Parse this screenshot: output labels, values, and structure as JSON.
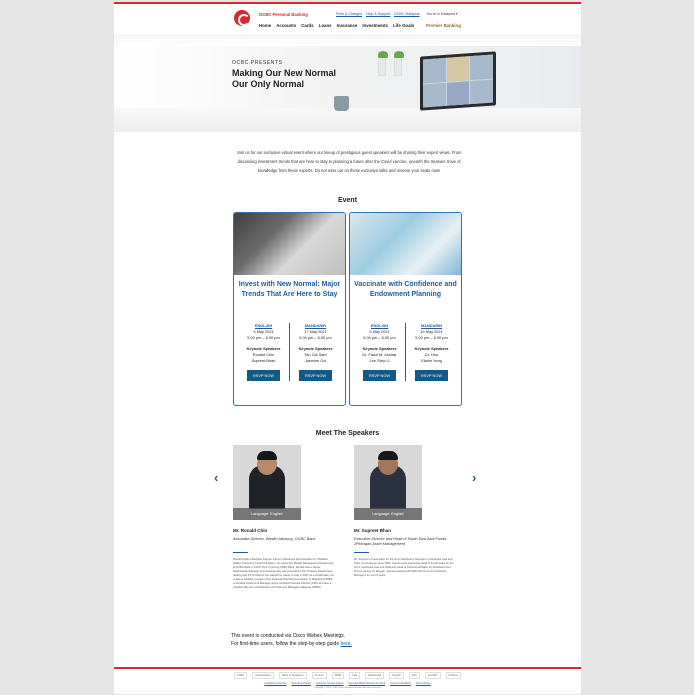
{
  "header": {
    "brand": "OCBC Personal Banking",
    "utility_links": [
      "Fees & Charges",
      "Help & Support",
      "OCBC Malaysia"
    ],
    "region_selector": "You're in Malaysia",
    "nav": [
      "Home",
      "Accounts",
      "Cards",
      "Loans",
      "Insurance",
      "Investments",
      "Life Goals"
    ],
    "premier": "Premier Banking"
  },
  "hero": {
    "presents": "OCBC PRESENTS",
    "title": "Making Our New Normal Our Only Normal"
  },
  "intro": "Join us for our exclusive virtual event where our lineup of prestigious guest speakers will be sharing their expert views. From discussing investment trends that are here to stay to planning a future after the Covid vaccine, unearth the treasure trove of knowledge from these experts. Do not miss out on these exclusive talks and reserve your seats now!",
  "event": {
    "heading": "Event",
    "cards": [
      {
        "title": "Invest with New Normal: Major Trends That Are Here to Stay",
        "sessions": [
          {
            "lang": "ENGLISH",
            "date": "3 May 2021",
            "time": "5.00 pm – 6.00 pm",
            "ks_label": "Keynote Speakers",
            "speakers": [
              "Ronald Chin",
              "Supreet Bhan"
            ],
            "rsvp": "RSVP NOW"
          },
          {
            "lang": "MANDARIN",
            "date": "17 May 2021",
            "time": "5.00 pm – 6.00 pm",
            "ks_label": "Keynote Speakers",
            "speakers": [
              "Tan Cia Sam",
              "Jasmine Ooi"
            ],
            "rsvp": "RSVP NOW"
          }
        ]
      },
      {
        "title": "Vaccinate with Confidence and Endowment Planning",
        "sessions": [
          {
            "lang": "ENGLISH",
            "date": "5 May 2021",
            "time": "5.00 pm – 6.00 pm",
            "ks_label": "Keynote Speakers",
            "speakers": [
              "Dr. Fauzi M. Anshar",
              "Lee Siew Li"
            ],
            "rsvp": "RSVP NOW"
          },
          {
            "lang": "MANDARIN",
            "date": "19 May 2021",
            "time": "5.00 pm – 6.00 pm",
            "ks_label": "Keynote Speakers",
            "speakers": [
              "Dr. Hoo",
              "Elaine Yong"
            ],
            "rsvp": "RSVP NOW"
          }
        ]
      }
    ]
  },
  "speakers": {
    "heading": "Meet The Speakers",
    "prev_icon": "‹",
    "next_icon": "›",
    "items": [
      {
        "language": "Language: English",
        "name": "Mr. Ronald Chin",
        "role": "Associate Director, Wealth Advisory, OCBC Bank",
        "bio": "Ronald holds a Bachelor Degree (Hons) in Business Administration by Sheffield Hallam University (United Kingdom). He joined the Wealth Management Department of OCBC Bank in 2016. Prior to joining OCBC Bank, Ronald was a Senior Relationship Manager and subsequently was promoted to the Treasury Department, dealing with FX & Options. He started his career in Asia in 2007 as a stockbroker. He is also a certified member of the Financial Planning Association of Malaysia (FPAM), a Certified Investment Manager and a Certified Financial Planner (CFP) and also a Certified Member of Federation of Investment Managers Malaysia (FIMM)."
      },
      {
        "language": "Language: English",
        "name": "Mr. Supreet Bhan",
        "role": "Executive Director and Head of South East Asia Funds, JPMorgan Asset Management",
        "bio": "Mr. Supreet is responsible for the firm's distribution business in Southeast Asia and India. An employee since 2005, Supreet was previously Head of Funds sales for the firm's Southeast Asia and India and Head of Institutional Sales for Southeast Asia. Prior to joining JP Morgan, Supreet worked with DSP Merrill Lynch Investment Managers for over 8 years."
      }
    ]
  },
  "webex": {
    "line1": "This event is conducted via Cisco Webex Meetings.",
    "line2": "For first-time users, follow the step-by-step guide",
    "link": "here."
  },
  "footer": {
    "logos": [
      "OCBC",
      "Great Eastern",
      "Bank of Singapore",
      "Al-Amin",
      "PIDM",
      "Visa",
      "Mastercard",
      "PayNet",
      "FPX",
      "JomPAY",
      "DuitNow"
    ],
    "links": [
      "Conditions of Access",
      "Security & Privacy",
      "Customer Service Charter",
      "Personal Data Protection Act 2010",
      "Terms & Conditions",
      "Client Charter"
    ],
    "copyright": "Copyright © 2021 OCBC Bank (Malaysia) Berhad. All rights reserved."
  },
  "colors": {
    "accent": "#d7282f",
    "primary": "#1f5b9d",
    "button": "#105a89"
  }
}
